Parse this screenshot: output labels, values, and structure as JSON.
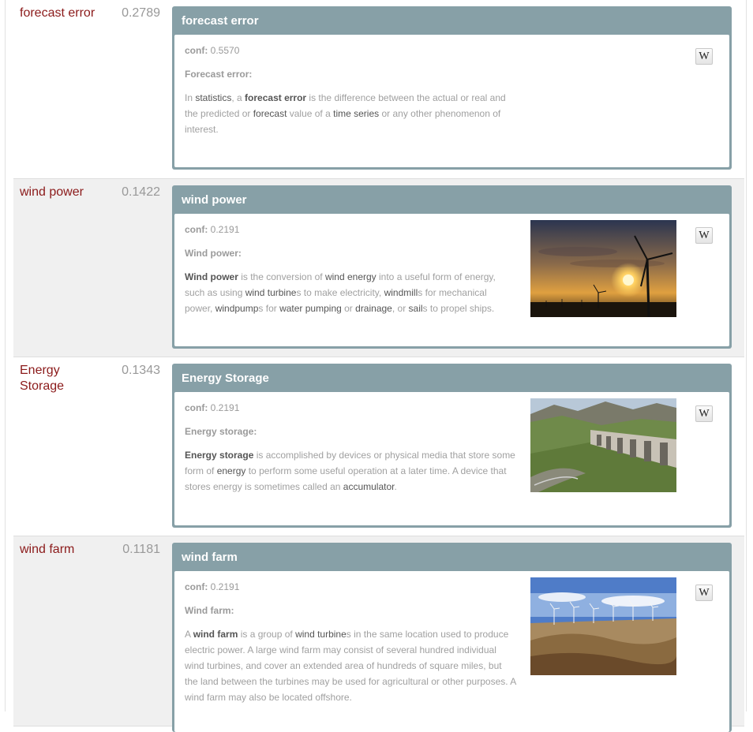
{
  "results": [
    {
      "term": "forecast error",
      "score": "0.2789",
      "title": "forecast error",
      "conf_label": "conf:",
      "conf_value": "0.5570",
      "subheading": "Forecast error:",
      "desc": [
        {
          "t": "In "
        },
        {
          "t": "statistics",
          "s": "k"
        },
        {
          "t": ", a "
        },
        {
          "t": "forecast error",
          "s": "kb"
        },
        {
          "t": " is the difference between the actual or real and the predicted or "
        },
        {
          "t": "forecast",
          "s": "k"
        },
        {
          "t": " value of a "
        },
        {
          "t": "time series",
          "s": "k"
        },
        {
          "t": " or any other phenomenon of interest."
        }
      ],
      "wiki_label": "W",
      "image": null
    },
    {
      "term": "wind power",
      "score": "0.1422",
      "title": "wind power",
      "conf_label": "conf:",
      "conf_value": "0.2191",
      "subheading": "Wind power:",
      "desc": [
        {
          "t": "Wind power",
          "s": "kb"
        },
        {
          "t": " is the conversion of "
        },
        {
          "t": "wind energy",
          "s": "k"
        },
        {
          "t": " into a useful form of energy, such as using "
        },
        {
          "t": "wind turbine",
          "s": "k"
        },
        {
          "t": "s to make electricity, "
        },
        {
          "t": "windmill",
          "s": "k"
        },
        {
          "t": "s for mechanical power, "
        },
        {
          "t": "windpump",
          "s": "k"
        },
        {
          "t": "s for "
        },
        {
          "t": "water pumping",
          "s": "k"
        },
        {
          "t": " or "
        },
        {
          "t": "drainage",
          "s": "k"
        },
        {
          "t": ", or "
        },
        {
          "t": "sail",
          "s": "k"
        },
        {
          "t": "s to propel ships."
        }
      ],
      "wiki_label": "W",
      "image": "sunset-wind-turbine"
    },
    {
      "term": "Energy Storage",
      "score": "0.1343",
      "title": "Energy Storage",
      "conf_label": "conf:",
      "conf_value": "0.2191",
      "subheading": "Energy storage:",
      "desc": [
        {
          "t": "Energy storage",
          "s": "kb"
        },
        {
          "t": " is accomplished by devices or physical media that store some form of "
        },
        {
          "t": "energy",
          "s": "k"
        },
        {
          "t": " to perform some useful operation at a later time. A device that stores energy is sometimes called an "
        },
        {
          "t": "accumulator",
          "s": "k"
        },
        {
          "t": "."
        }
      ],
      "wiki_label": "W",
      "image": "dam-in-mountains"
    },
    {
      "term": "wind farm",
      "score": "0.1181",
      "title": "wind farm",
      "conf_label": "conf:",
      "conf_value": "0.2191",
      "subheading": "Wind farm:",
      "desc": [
        {
          "t": "A "
        },
        {
          "t": "wind farm",
          "s": "kb"
        },
        {
          "t": " is a group of "
        },
        {
          "t": "wind turbine",
          "s": "k"
        },
        {
          "t": "s in the same location used to produce electric power. A large wind farm may consist of several hundred individual wind turbines, and cover an extended area of hundreds of square miles, but the land between the turbines may be used for agricultural or other purposes. A wind farm may also be located offshore."
        }
      ],
      "wiki_label": "W",
      "image": "wind-farm-hills"
    }
  ],
  "colors": {
    "term": "#8b1a1a",
    "score": "#999999",
    "card_header": "#87a0a7",
    "row_shade": "#f0f0f0",
    "keyword": "#555555",
    "body_text": "#a0a0a0"
  }
}
